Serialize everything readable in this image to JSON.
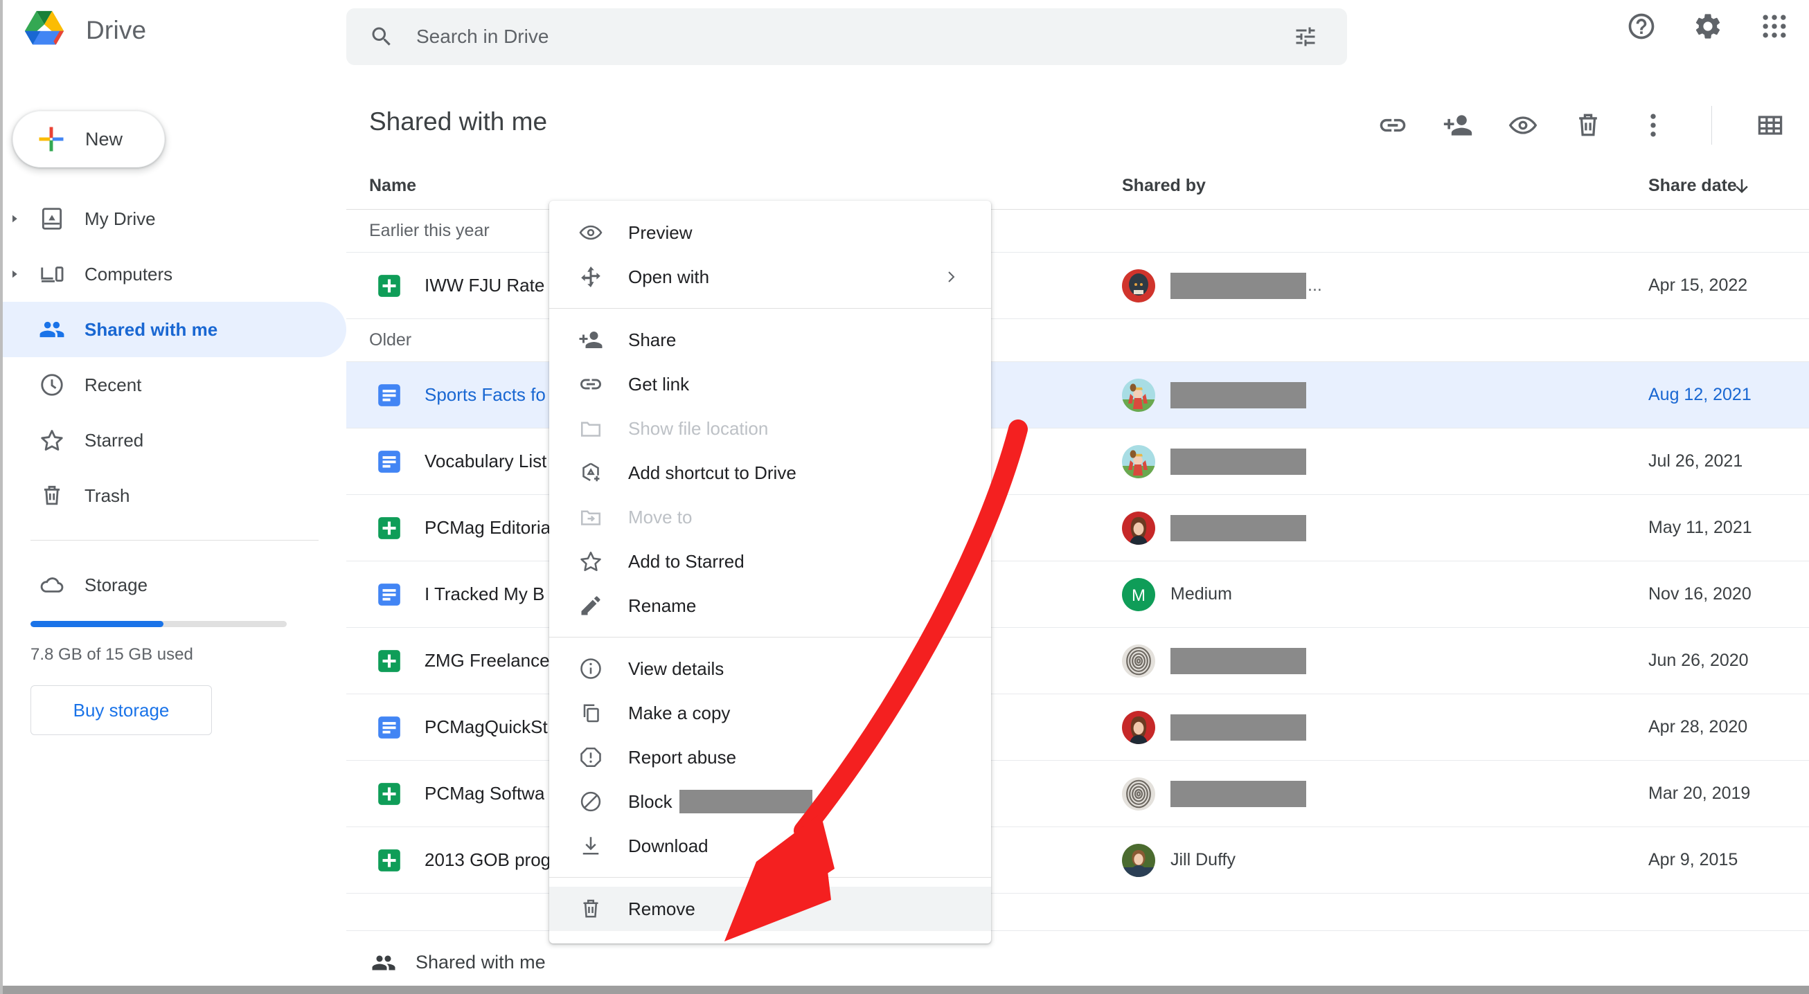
{
  "app": {
    "brand_name": "Drive",
    "logo_icon": "drive-triangle-logo"
  },
  "search": {
    "placeholder": "Search in Drive",
    "value": "",
    "search_icon": "search-icon",
    "filter_icon": "tune-filter-icon"
  },
  "header_actions": [
    {
      "name": "help",
      "icon": "help-circle-icon"
    },
    {
      "name": "settings",
      "icon": "gear-icon"
    },
    {
      "name": "google-apps",
      "icon": "apps-grid-icon"
    }
  ],
  "sidebar": {
    "new_button": {
      "label": "New",
      "icon": "plus-icon"
    },
    "items": [
      {
        "label": "My Drive",
        "icon": "my-drive-icon",
        "expandable": true,
        "active": false
      },
      {
        "label": "Computers",
        "icon": "computers-icon",
        "expandable": true,
        "active": false
      },
      {
        "label": "Shared with me",
        "icon": "people-icon",
        "expandable": false,
        "active": true
      },
      {
        "label": "Recent",
        "icon": "clock-icon",
        "expandable": false,
        "active": false
      },
      {
        "label": "Starred",
        "icon": "star-icon",
        "expandable": false,
        "active": false
      },
      {
        "label": "Trash",
        "icon": "trash-icon",
        "expandable": false,
        "active": false
      }
    ],
    "storage": {
      "label": "Storage",
      "icon": "cloud-icon",
      "usage_text": "7.8 GB of 15 GB used",
      "percent_used": 52,
      "buy_label": "Buy storage"
    }
  },
  "main": {
    "page_title": "Shared with me",
    "toolbar": [
      {
        "name": "get-link",
        "icon": "link-icon"
      },
      {
        "name": "share",
        "icon": "person-add-icon"
      },
      {
        "name": "preview",
        "icon": "eye-icon"
      },
      {
        "name": "remove",
        "icon": "trash-icon"
      },
      {
        "name": "more-actions",
        "icon": "more-vert-icon"
      },
      {
        "name": "grid-view",
        "icon": "grid-view-icon"
      }
    ],
    "columns": {
      "name": "Name",
      "shared_by": "Shared by",
      "share_date": "Share date",
      "sort_icon": "arrow-down-icon",
      "sort_direction": "descending"
    },
    "groups": [
      {
        "label": "Earlier this year",
        "rows": [
          {
            "file_name": "IWW FJU Rate S",
            "file_type": "sheets",
            "sharer_name": "",
            "sharer_redacted": true,
            "redact_width": 196,
            "redact_ellipsis": "...",
            "avatar_type": "photo-wolf",
            "share_date": "Apr 15, 2022",
            "selected": false
          }
        ]
      },
      {
        "label": "Older",
        "rows": [
          {
            "file_name": "Sports Facts fo",
            "file_type": "docs",
            "sharer_name": "",
            "sharer_redacted": true,
            "redact_width": 196,
            "redact_ellipsis": "",
            "avatar_type": "photo-child",
            "share_date": "Aug 12, 2021",
            "selected": true
          },
          {
            "file_name": "Vocabulary List",
            "file_type": "docs",
            "sharer_name": "",
            "sharer_redacted": true,
            "redact_width": 196,
            "redact_ellipsis": "",
            "avatar_type": "photo-child",
            "share_date": "Jul 26, 2021",
            "selected": false
          },
          {
            "file_name": "PCMag Editoria",
            "file_type": "sheets",
            "sharer_name": "",
            "sharer_redacted": true,
            "redact_width": 196,
            "redact_ellipsis": "",
            "avatar_type": "photo-woman",
            "share_date": "May 11, 2021",
            "selected": false
          },
          {
            "file_name": "I Tracked My B",
            "file_type": "docs",
            "sharer_name": "Medium",
            "sharer_redacted": false,
            "redact_width": 0,
            "redact_ellipsis": "",
            "avatar_type": "badge-medium",
            "share_date": "Nov 16, 2020",
            "selected": false
          },
          {
            "file_name": "ZMG Freelance",
            "file_type": "sheets",
            "sharer_name": "",
            "sharer_redacted": true,
            "redact_width": 196,
            "redact_ellipsis": "",
            "avatar_type": "photo-fingerprint",
            "share_date": "Jun 26, 2020",
            "selected": false
          },
          {
            "file_name": "PCMagQuickSt",
            "file_type": "docs",
            "sharer_name": "",
            "sharer_redacted": true,
            "redact_width": 196,
            "redact_ellipsis": "",
            "avatar_type": "photo-woman",
            "share_date": "Apr 28, 2020",
            "selected": false
          },
          {
            "file_name": "PCMag Softwa",
            "file_type": "sheets",
            "sharer_name": "",
            "sharer_redacted": true,
            "redact_width": 196,
            "redact_ellipsis": "",
            "avatar_type": "photo-fingerprint",
            "share_date": "Mar 20, 2019",
            "selected": false
          },
          {
            "file_name": "2013 GOB prog",
            "file_type": "sheets",
            "sharer_name": "Jill Duffy",
            "sharer_redacted": false,
            "redact_width": 0,
            "redact_ellipsis": "",
            "avatar_type": "photo-jill",
            "share_date": "Apr 9, 2015",
            "selected": false
          }
        ]
      }
    ],
    "statusbar": {
      "label": "Shared with me",
      "icon": "people-icon"
    }
  },
  "context_menu": {
    "sections": [
      {
        "items": [
          {
            "label": "Preview",
            "icon": "eye-icon",
            "disabled": false,
            "submenu": false,
            "hovered": false,
            "redacted": false
          },
          {
            "label": "Open with",
            "icon": "open-with-move-icon",
            "disabled": false,
            "submenu": true,
            "hovered": false,
            "redacted": false
          }
        ]
      },
      {
        "items": [
          {
            "label": "Share",
            "icon": "person-add-icon",
            "disabled": false,
            "submenu": false,
            "hovered": false,
            "redacted": false
          },
          {
            "label": "Get link",
            "icon": "link-icon",
            "disabled": false,
            "submenu": false,
            "hovered": false,
            "redacted": false
          },
          {
            "label": "Show file location",
            "icon": "folder-icon",
            "disabled": true,
            "submenu": false,
            "hovered": false,
            "redacted": false
          },
          {
            "label": "Add shortcut to Drive",
            "icon": "add-shortcut-icon",
            "disabled": false,
            "submenu": false,
            "hovered": false,
            "redacted": false
          },
          {
            "label": "Move to",
            "icon": "folder-move-icon",
            "disabled": true,
            "submenu": false,
            "hovered": false,
            "redacted": false
          },
          {
            "label": "Add to Starred",
            "icon": "star-icon",
            "disabled": false,
            "submenu": false,
            "hovered": false,
            "redacted": false
          },
          {
            "label": "Rename",
            "icon": "pencil-icon",
            "disabled": false,
            "submenu": false,
            "hovered": false,
            "redacted": false
          }
        ]
      },
      {
        "items": [
          {
            "label": "View details",
            "icon": "info-icon",
            "disabled": false,
            "submenu": false,
            "hovered": false,
            "redacted": false
          },
          {
            "label": "Make a copy",
            "icon": "copy-icon",
            "disabled": false,
            "submenu": false,
            "hovered": false,
            "redacted": false
          },
          {
            "label": "Report abuse",
            "icon": "report-icon",
            "disabled": false,
            "submenu": false,
            "hovered": false,
            "redacted": false
          },
          {
            "label": "Block",
            "icon": "block-icon",
            "disabled": false,
            "submenu": false,
            "hovered": false,
            "redacted": true
          },
          {
            "label": "Download",
            "icon": "download-icon",
            "disabled": false,
            "submenu": false,
            "hovered": false,
            "redacted": false
          }
        ]
      },
      {
        "items": [
          {
            "label": "Remove",
            "icon": "trash-icon",
            "disabled": false,
            "submenu": false,
            "hovered": true,
            "redacted": false
          }
        ]
      }
    ]
  },
  "annotation": {
    "arrow_color": "#f42020",
    "arrow_points_to": "Remove",
    "arrow_icon": "curved-arrow-annotation"
  },
  "colors": {
    "accent_blue": "#1a73e8",
    "selected_row_bg": "#e8f0fe",
    "sheets_green": "#0f9d58",
    "docs_blue": "#4285f4",
    "redaction_gray": "#8a8a8a"
  }
}
